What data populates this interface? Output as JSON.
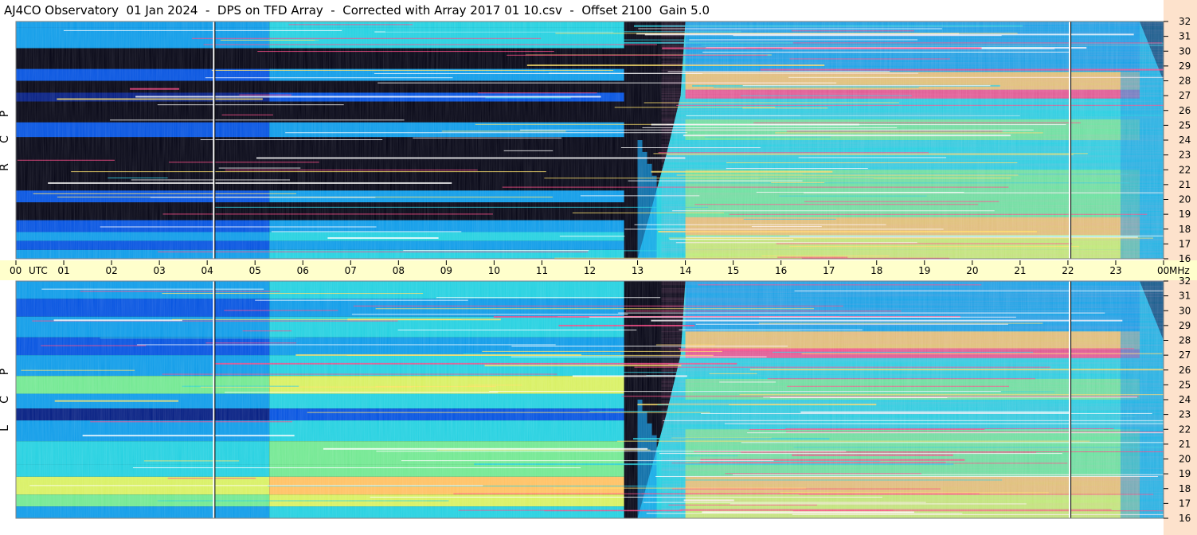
{
  "title": "AJ4CO Observatory  01 Jan 2024  -  DPS on TFD Array  -  Corrected with Array 2017 01 10.csv  -  Offset 2100  Gain 5.0",
  "chart_data": {
    "type": "heatmap",
    "title": "AJ4CO Observatory  01 Jan 2024  -  DPS on TFD Array  -  Corrected with Array 2017 01 10.csv  -  Offset 2100  Gain 5.0",
    "x_tick_labels": [
      "00",
      "01",
      "02",
      "03",
      "04",
      "05",
      "06",
      "07",
      "08",
      "09",
      "10",
      "11",
      "12",
      "13",
      "14",
      "15",
      "16",
      "17",
      "18",
      "19",
      "20",
      "21",
      "22",
      "23",
      "00"
    ],
    "x_unit": "UTC",
    "y_unit": "MHz",
    "y_tick_labels": [
      "32",
      "31",
      "30",
      "29",
      "28",
      "27",
      "26",
      "25",
      "24",
      "23",
      "22",
      "21",
      "20",
      "19",
      "18",
      "17",
      "16"
    ],
    "x_range_hours": [
      0,
      24
    ],
    "y_range_mhz": [
      16,
      32
    ],
    "panels": [
      {
        "label": [
          "R",
          "C",
          "P"
        ]
      },
      {
        "label": [
          "L",
          "C",
          "P"
        ]
      }
    ],
    "colormap": [
      "#000010",
      "#001a80",
      "#0050e0",
      "#0a9ae8",
      "#20d0e0",
      "#70e890",
      "#d8f060",
      "#ffc060",
      "#ff4080",
      "#ffffff"
    ]
  }
}
